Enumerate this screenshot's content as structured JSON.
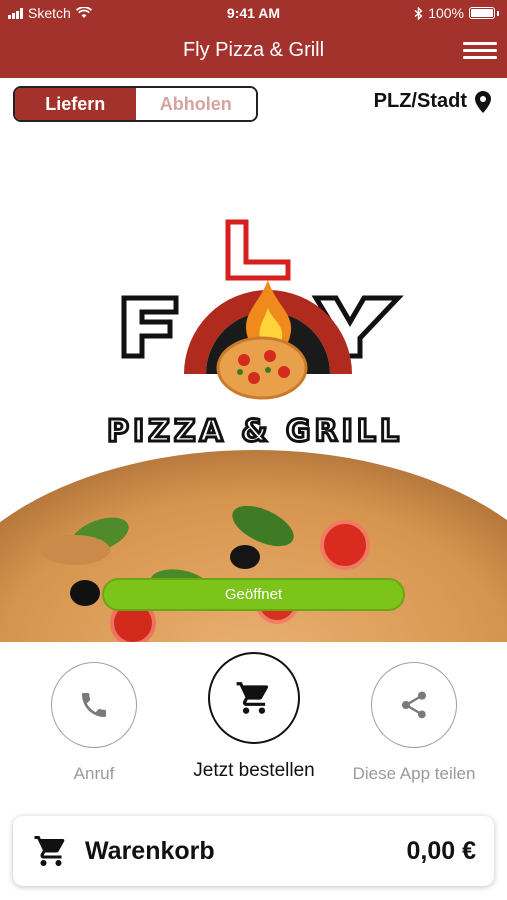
{
  "status_bar": {
    "carrier": "Sketch",
    "time": "9:41 AM",
    "battery": "100%"
  },
  "header": {
    "title": "Fly Pizza & Grill"
  },
  "order_mode": {
    "options": [
      "Liefern",
      "Abholen"
    ],
    "selected": "Liefern"
  },
  "location": {
    "label": "PLZ/Stadt"
  },
  "hero": {
    "logo_main": "FLY",
    "logo_sub": "PIZZA & GRILL",
    "status": "Geöffnet"
  },
  "actions": [
    {
      "label": "Anruf",
      "icon": "phone-icon"
    },
    {
      "label": "Jetzt bestellen",
      "icon": "cart-icon"
    },
    {
      "label": "Diese App teilen",
      "icon": "share-icon"
    }
  ],
  "cart": {
    "label": "Warenkorb",
    "total": "0,00 €"
  },
  "colors": {
    "brand": "#a3322c",
    "open_status": "#7cc41a"
  }
}
